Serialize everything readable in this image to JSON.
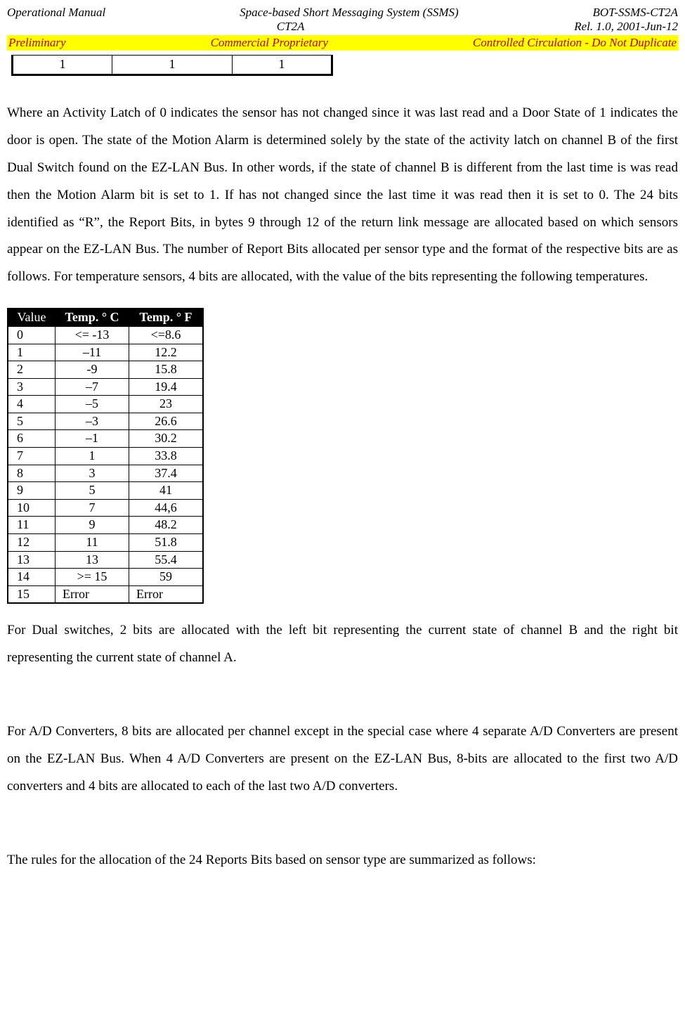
{
  "header": {
    "row1": {
      "left": "Operational Manual",
      "center": "Space-based Short Messaging System (SSMS)",
      "right": "BOT-SSMS-CT2A"
    },
    "row2": {
      "left": "",
      "center": "CT2A",
      "right": "Rel. 1.0, 2001-Jun-12"
    },
    "banner": {
      "left": "Preliminary",
      "center": "Commercial Proprietary",
      "right": "Controlled Circulation - Do Not Duplicate"
    }
  },
  "small_table": {
    "c1": "1",
    "c2": "1",
    "c3": "1"
  },
  "paragraph1": "Where an Activity Latch of 0 indicates the sensor has not changed since it was last read and a Door State of 1 indicates the door is open. The state of the Motion Alarm is determined solely by the state of the activity latch on channel B of the first Dual Switch found on the EZ-LAN Bus. In other words, if the state of channel B is different from the last time is was read then the Motion Alarm bit is set to 1. If has not changed since the last time it was read then it is set to 0. The 24  bits identified as “R”, the Report Bits, in bytes 9 through 12 of the return link message are allocated based on which sensors appear on the EZ-LAN Bus. The number of Report Bits allocated per sensor type and the format of the respective bits are as follows. For temperature sensors, 4 bits are allocated, with the value of the bits representing the following temperatures.",
  "temp_table": {
    "headers": {
      "value": "Value",
      "temp_c": "Temp. ° C",
      "temp_f": "Temp. ° F"
    },
    "rows": [
      {
        "value": "0",
        "c": "<= -13",
        "f": "<=8.6"
      },
      {
        "value": "1",
        "c": "–11",
        "f": "12.2"
      },
      {
        "value": "2",
        "c": "-9",
        "f": "15.8"
      },
      {
        "value": "3",
        "c": "–7",
        "f": "19.4"
      },
      {
        "value": "4",
        "c": "–5",
        "f": "23"
      },
      {
        "value": "5",
        "c": "–3",
        "f": "26.6"
      },
      {
        "value": "6",
        "c": "–1",
        "f": "30.2"
      },
      {
        "value": "7",
        "c": "1",
        "f": "33.8"
      },
      {
        "value": "8",
        "c": "3",
        "f": "37.4"
      },
      {
        "value": "9",
        "c": "5",
        "f": "41"
      },
      {
        "value": "10",
        "c": "7",
        "f": "44,6"
      },
      {
        "value": "11",
        "c": "9",
        "f": "48.2"
      },
      {
        "value": "12",
        "c": "11",
        "f": "51.8"
      },
      {
        "value": "13",
        "c": "13",
        "f": "55.4"
      },
      {
        "value": "14",
        "c": ">= 15",
        "f": "59"
      },
      {
        "value": "15",
        "c": "Error",
        "f": "Error"
      }
    ]
  },
  "paragraph2": "For Dual switches, 2 bits are allocated with the left bit representing the current state of channel B and the right bit representing the current state of channel A.",
  "paragraph3": "For A/D Converters, 8 bits are allocated per channel except in the special case where 4 separate A/D Converters are present on the EZ-LAN Bus.  When 4 A/D Converters are present on the EZ-LAN Bus, 8-bits are allocated to the first two A/D converters and 4 bits are allocated to each of the last two A/D converters.",
  "paragraph4": "The rules for the allocation of the 24 Reports Bits based on sensor type are summarized as follows:",
  "chart_data": {
    "type": "table",
    "title": "Temperature sensor 4-bit value mapping",
    "columns": [
      "Value",
      "Temp. ° C",
      "Temp. ° F"
    ],
    "rows": [
      [
        "0",
        "<= -13",
        "<=8.6"
      ],
      [
        "1",
        "-11",
        "12.2"
      ],
      [
        "2",
        "-9",
        "15.8"
      ],
      [
        "3",
        "-7",
        "19.4"
      ],
      [
        "4",
        "-5",
        "23"
      ],
      [
        "5",
        "-3",
        "26.6"
      ],
      [
        "6",
        "-1",
        "30.2"
      ],
      [
        "7",
        "1",
        "33.8"
      ],
      [
        "8",
        "3",
        "37.4"
      ],
      [
        "9",
        "5",
        "41"
      ],
      [
        "10",
        "7",
        "44,6"
      ],
      [
        "11",
        "9",
        "48.2"
      ],
      [
        "12",
        "11",
        "51.8"
      ],
      [
        "13",
        "13",
        "55.4"
      ],
      [
        "14",
        ">= 15",
        "59"
      ],
      [
        "15",
        "Error",
        "Error"
      ]
    ]
  }
}
